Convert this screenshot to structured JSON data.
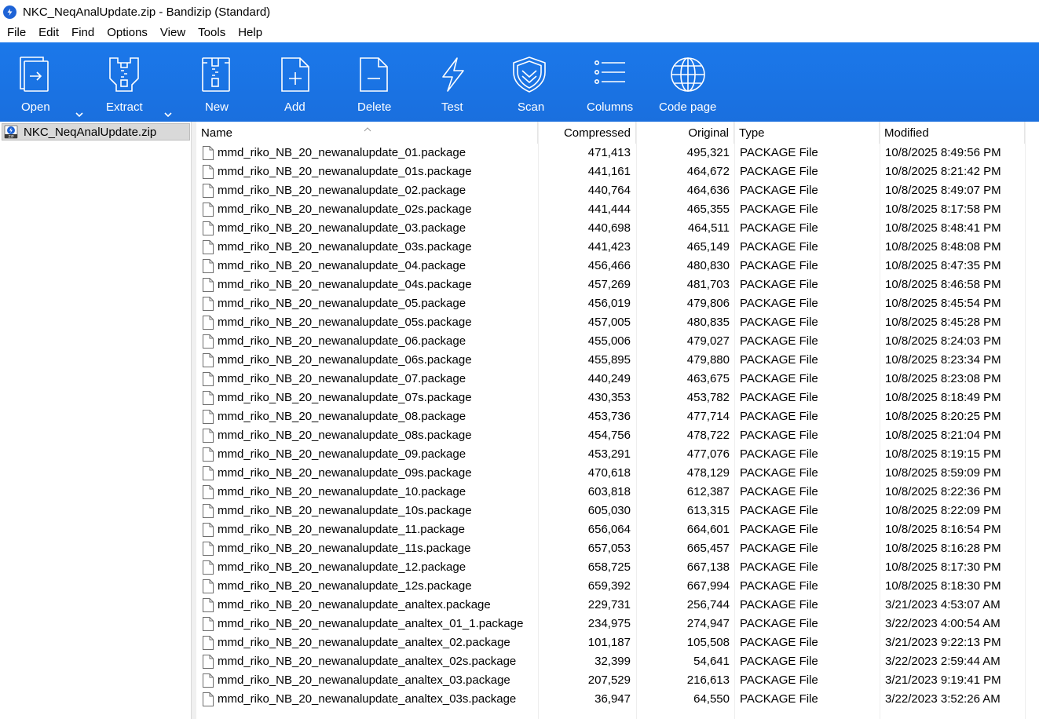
{
  "window": {
    "title": "NKC_NeqAnalUpdate.zip - Bandizip (Standard)"
  },
  "menu": [
    "File",
    "Edit",
    "Find",
    "Options",
    "View",
    "Tools",
    "Help"
  ],
  "toolbar": {
    "open": "Open",
    "extract": "Extract",
    "new": "New",
    "add": "Add",
    "delete": "Delete",
    "test": "Test",
    "scan": "Scan",
    "columns": "Columns",
    "code_page": "Code page"
  },
  "sidebar": {
    "archive_name": "NKC_NeqAnalUpdate.zip"
  },
  "columns": {
    "name": "Name",
    "compressed": "Compressed",
    "original": "Original",
    "type": "Type",
    "modified": "Modified"
  },
  "files": [
    {
      "name": "mmd_riko_NB_20_newanalupdate_01.package",
      "compressed": "471,413",
      "original": "495,321",
      "type": "PACKAGE File",
      "modified": "10/8/2025 8:49:56 PM"
    },
    {
      "name": "mmd_riko_NB_20_newanalupdate_01s.package",
      "compressed": "441,161",
      "original": "464,672",
      "type": "PACKAGE File",
      "modified": "10/8/2025 8:21:42 PM"
    },
    {
      "name": "mmd_riko_NB_20_newanalupdate_02.package",
      "compressed": "440,764",
      "original": "464,636",
      "type": "PACKAGE File",
      "modified": "10/8/2025 8:49:07 PM"
    },
    {
      "name": "mmd_riko_NB_20_newanalupdate_02s.package",
      "compressed": "441,444",
      "original": "465,355",
      "type": "PACKAGE File",
      "modified": "10/8/2025 8:17:58 PM"
    },
    {
      "name": "mmd_riko_NB_20_newanalupdate_03.package",
      "compressed": "440,698",
      "original": "464,511",
      "type": "PACKAGE File",
      "modified": "10/8/2025 8:48:41 PM"
    },
    {
      "name": "mmd_riko_NB_20_newanalupdate_03s.package",
      "compressed": "441,423",
      "original": "465,149",
      "type": "PACKAGE File",
      "modified": "10/8/2025 8:48:08 PM"
    },
    {
      "name": "mmd_riko_NB_20_newanalupdate_04.package",
      "compressed": "456,466",
      "original": "480,830",
      "type": "PACKAGE File",
      "modified": "10/8/2025 8:47:35 PM"
    },
    {
      "name": "mmd_riko_NB_20_newanalupdate_04s.package",
      "compressed": "457,269",
      "original": "481,703",
      "type": "PACKAGE File",
      "modified": "10/8/2025 8:46:58 PM"
    },
    {
      "name": "mmd_riko_NB_20_newanalupdate_05.package",
      "compressed": "456,019",
      "original": "479,806",
      "type": "PACKAGE File",
      "modified": "10/8/2025 8:45:54 PM"
    },
    {
      "name": "mmd_riko_NB_20_newanalupdate_05s.package",
      "compressed": "457,005",
      "original": "480,835",
      "type": "PACKAGE File",
      "modified": "10/8/2025 8:45:28 PM"
    },
    {
      "name": "mmd_riko_NB_20_newanalupdate_06.package",
      "compressed": "455,006",
      "original": "479,027",
      "type": "PACKAGE File",
      "modified": "10/8/2025 8:24:03 PM"
    },
    {
      "name": "mmd_riko_NB_20_newanalupdate_06s.package",
      "compressed": "455,895",
      "original": "479,880",
      "type": "PACKAGE File",
      "modified": "10/8/2025 8:23:34 PM"
    },
    {
      "name": "mmd_riko_NB_20_newanalupdate_07.package",
      "compressed": "440,249",
      "original": "463,675",
      "type": "PACKAGE File",
      "modified": "10/8/2025 8:23:08 PM"
    },
    {
      "name": "mmd_riko_NB_20_newanalupdate_07s.package",
      "compressed": "430,353",
      "original": "453,782",
      "type": "PACKAGE File",
      "modified": "10/8/2025 8:18:49 PM"
    },
    {
      "name": "mmd_riko_NB_20_newanalupdate_08.package",
      "compressed": "453,736",
      "original": "477,714",
      "type": "PACKAGE File",
      "modified": "10/8/2025 8:20:25 PM"
    },
    {
      "name": "mmd_riko_NB_20_newanalupdate_08s.package",
      "compressed": "454,756",
      "original": "478,722",
      "type": "PACKAGE File",
      "modified": "10/8/2025 8:21:04 PM"
    },
    {
      "name": "mmd_riko_NB_20_newanalupdate_09.package",
      "compressed": "453,291",
      "original": "477,076",
      "type": "PACKAGE File",
      "modified": "10/8/2025 8:19:15 PM"
    },
    {
      "name": "mmd_riko_NB_20_newanalupdate_09s.package",
      "compressed": "470,618",
      "original": "478,129",
      "type": "PACKAGE File",
      "modified": "10/8/2025 8:59:09 PM"
    },
    {
      "name": "mmd_riko_NB_20_newanalupdate_10.package",
      "compressed": "603,818",
      "original": "612,387",
      "type": "PACKAGE File",
      "modified": "10/8/2025 8:22:36 PM"
    },
    {
      "name": "mmd_riko_NB_20_newanalupdate_10s.package",
      "compressed": "605,030",
      "original": "613,315",
      "type": "PACKAGE File",
      "modified": "10/8/2025 8:22:09 PM"
    },
    {
      "name": "mmd_riko_NB_20_newanalupdate_11.package",
      "compressed": "656,064",
      "original": "664,601",
      "type": "PACKAGE File",
      "modified": "10/8/2025 8:16:54 PM"
    },
    {
      "name": "mmd_riko_NB_20_newanalupdate_11s.package",
      "compressed": "657,053",
      "original": "665,457",
      "type": "PACKAGE File",
      "modified": "10/8/2025 8:16:28 PM"
    },
    {
      "name": "mmd_riko_NB_20_newanalupdate_12.package",
      "compressed": "658,725",
      "original": "667,138",
      "type": "PACKAGE File",
      "modified": "10/8/2025 8:17:30 PM"
    },
    {
      "name": "mmd_riko_NB_20_newanalupdate_12s.package",
      "compressed": "659,392",
      "original": "667,994",
      "type": "PACKAGE File",
      "modified": "10/8/2025 8:18:30 PM"
    },
    {
      "name": "mmd_riko_NB_20_newanalupdate_analtex.package",
      "compressed": "229,731",
      "original": "256,744",
      "type": "PACKAGE File",
      "modified": "3/21/2023 4:53:07 AM"
    },
    {
      "name": "mmd_riko_NB_20_newanalupdate_analtex_01_1.package",
      "compressed": "234,975",
      "original": "274,947",
      "type": "PACKAGE File",
      "modified": "3/22/2023 4:00:54 AM"
    },
    {
      "name": "mmd_riko_NB_20_newanalupdate_analtex_02.package",
      "compressed": "101,187",
      "original": "105,508",
      "type": "PACKAGE File",
      "modified": "3/21/2023 9:22:13 PM"
    },
    {
      "name": "mmd_riko_NB_20_newanalupdate_analtex_02s.package",
      "compressed": "32,399",
      "original": "54,641",
      "type": "PACKAGE File",
      "modified": "3/22/2023 2:59:44 AM"
    },
    {
      "name": "mmd_riko_NB_20_newanalupdate_analtex_03.package",
      "compressed": "207,529",
      "original": "216,613",
      "type": "PACKAGE File",
      "modified": "3/21/2023 9:19:41 PM"
    },
    {
      "name": "mmd_riko_NB_20_newanalupdate_analtex_03s.package",
      "compressed": "36,947",
      "original": "64,550",
      "type": "PACKAGE File",
      "modified": "3/22/2023 3:52:26 AM"
    }
  ],
  "colors": {
    "toolbar_blue": "#1a72e5",
    "selected_bg": "#d9d9d9"
  }
}
